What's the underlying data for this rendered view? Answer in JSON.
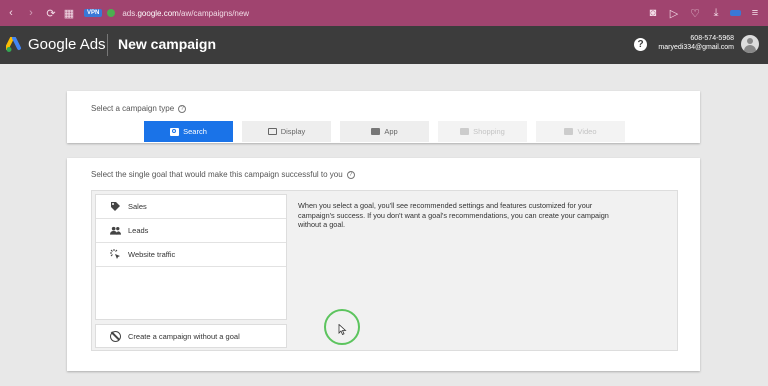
{
  "browser": {
    "url_prefix": "ads.",
    "url_domain": "google.com",
    "url_path": "/aw/campaigns/new",
    "vpn_label": "VPN"
  },
  "header": {
    "product_name": "Google Ads",
    "page_title": "New campaign",
    "account_phone": "608-574-5968",
    "account_email": "maryedi334@gmail.com",
    "help_label": "?"
  },
  "campaign_type": {
    "prompt": "Select a campaign type",
    "tabs": [
      {
        "label": "Search",
        "state": "active",
        "icon": "search-icon"
      },
      {
        "label": "Display",
        "state": "normal",
        "icon": "display-icon"
      },
      {
        "label": "App",
        "state": "normal",
        "icon": "app-icon"
      },
      {
        "label": "Shopping",
        "state": "disabled",
        "icon": "shopping-icon"
      },
      {
        "label": "Video",
        "state": "disabled",
        "icon": "video-icon"
      }
    ]
  },
  "goal": {
    "prompt": "Select the single goal that would make this campaign successful to you",
    "items": [
      {
        "label": "Sales",
        "icon": "tag-icon"
      },
      {
        "label": "Leads",
        "icon": "people-icon"
      },
      {
        "label": "Website traffic",
        "icon": "click-icon"
      }
    ],
    "no_goal_label": "Create a campaign without a goal",
    "description": "When you select a goal, you'll see recommended settings and features customized for your campaign's success. If you don't want a goal's recommendations, you can create your campaign without a goal."
  },
  "colors": {
    "browser_bar": "#a0446f",
    "app_bar": "#3c3c3c",
    "accent": "#1a73e8",
    "cursor_ring": "#5cc45e"
  }
}
